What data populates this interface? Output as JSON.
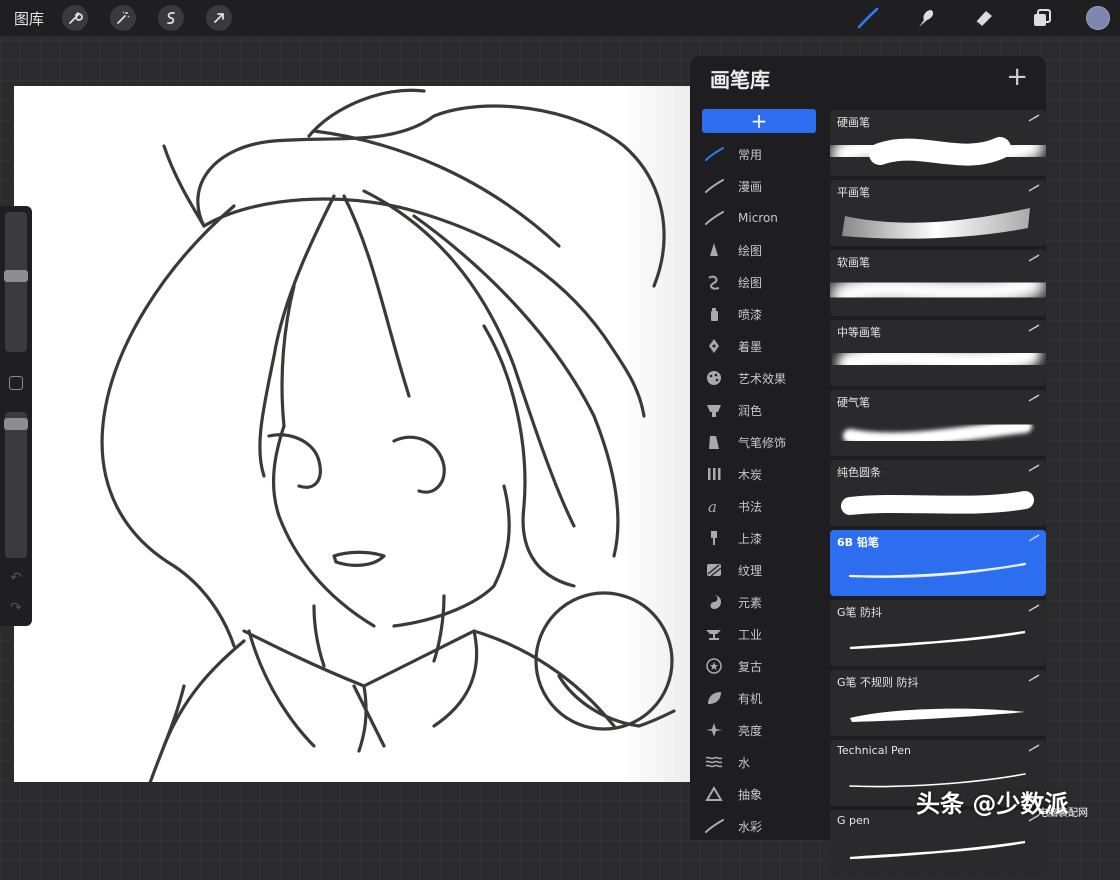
{
  "topbar": {
    "gallery_label": "图库",
    "left_tools": [
      "wrench-icon",
      "magic-wand-icon",
      "selection-icon",
      "transform-arrow-icon"
    ],
    "right_tools": [
      "brush-icon",
      "smudge-icon",
      "eraser-icon",
      "layers-icon"
    ],
    "current_color": "#7d86b0"
  },
  "panel": {
    "title": "画笔库",
    "add_symbol": "+",
    "category_add_symbol": "+",
    "categories": [
      {
        "label": "常用",
        "icon": "stroke-icon"
      },
      {
        "label": "漫画",
        "icon": "stroke-icon"
      },
      {
        "label": "Micron",
        "icon": "stroke-icon"
      },
      {
        "label": "绘图",
        "icon": "pencil-tip-icon"
      },
      {
        "label": "绘图",
        "icon": "curl-icon"
      },
      {
        "label": "喷漆",
        "icon": "spray-can-icon"
      },
      {
        "label": "着墨",
        "icon": "ink-nib-icon"
      },
      {
        "label": "艺术效果",
        "icon": "palette-icon"
      },
      {
        "label": "润色",
        "icon": "sponge-icon"
      },
      {
        "label": "气笔修饰",
        "icon": "airbrush-icon"
      },
      {
        "label": "木炭",
        "icon": "charcoal-icon"
      },
      {
        "label": "书法",
        "icon": "calligraphy-icon"
      },
      {
        "label": "上漆",
        "icon": "paint-brush-icon"
      },
      {
        "label": "纹理",
        "icon": "texture-icon"
      },
      {
        "label": "元素",
        "icon": "yin-yang-icon"
      },
      {
        "label": "工业",
        "icon": "anvil-icon"
      },
      {
        "label": "复古",
        "icon": "star-badge-icon"
      },
      {
        "label": "有机",
        "icon": "leaf-icon"
      },
      {
        "label": "亮度",
        "icon": "sparkle-icon"
      },
      {
        "label": "水",
        "icon": "waves-icon"
      },
      {
        "label": "抽象",
        "icon": "triangle-icon"
      },
      {
        "label": "水彩",
        "icon": "stroke-icon"
      }
    ],
    "brushes": [
      {
        "name": "硬画笔",
        "style": "airbrush-hard",
        "selected": false
      },
      {
        "name": "平画笔",
        "style": "flat",
        "selected": false
      },
      {
        "name": "软画笔",
        "style": "soft",
        "selected": false
      },
      {
        "name": "中等画笔",
        "style": "soft-medium",
        "selected": false
      },
      {
        "name": "硬气笔",
        "style": "hard-taper",
        "selected": false
      },
      {
        "name": "纯色圆条",
        "style": "solid-round",
        "selected": false
      },
      {
        "name": "6B 铅笔",
        "style": "pencil",
        "selected": true
      },
      {
        "name": "G笔 防抖",
        "style": "gpen",
        "selected": false
      },
      {
        "name": "G笔 不规则 防抖",
        "style": "gpen-rough",
        "selected": false
      },
      {
        "name": "Technical Pen",
        "style": "tech",
        "selected": false
      },
      {
        "name": "G pen",
        "style": "gpen",
        "selected": false
      }
    ]
  },
  "watermark": {
    "main": "头条 @少数派",
    "site": "电脑装配网"
  },
  "colors": {
    "accent": "#2d6ef0",
    "panel_bg": "#1e1e20",
    "canvas_bg": "#ffffff"
  }
}
